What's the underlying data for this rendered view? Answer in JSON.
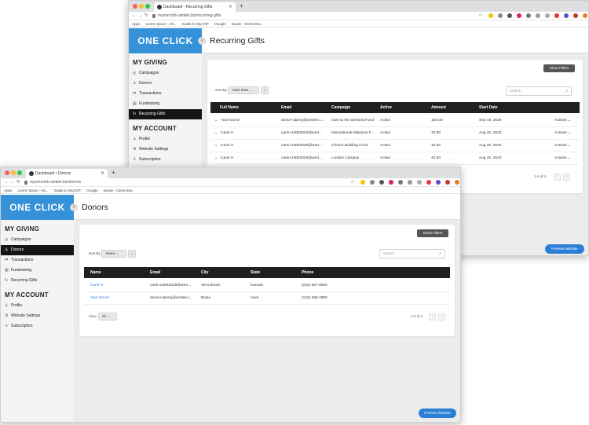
{
  "back_window": {
    "tab_title": "Dashboard - Recurring Gifts",
    "url": "myonnclick.wmtek.biz/recurring-gifts",
    "bookmarks": [
      "Apps",
      "Lorem Ipsum - All...",
      "Guide to WyAOP",
      "Google",
      "Bowie - Client Bra..."
    ],
    "logo": "ONE CLICK",
    "page_title": "Recurring Gifts",
    "sidebar": {
      "my_giving": "MY GIVING",
      "giving_items": [
        "Campaigns",
        "Donors",
        "Transactions",
        "Fundraising",
        "Recurring Gifts"
      ],
      "my_account": "MY ACCOUNT",
      "account_items": [
        "Profile",
        "Website Settings",
        "Subscription"
      ]
    },
    "show_filters": "Show Filters",
    "sort_by": "Sort By",
    "sort_value": "Start Date ⌄",
    "sort_dir": "↓",
    "search_placeholder": "Search",
    "columns": [
      "Full Name",
      "Email",
      "Campaign",
      "Active",
      "Amount",
      "Start Date"
    ],
    "rows": [
      {
        "name": "Your Donor",
        "email": "donor+danny@wmtek.c...",
        "campaign": "Give to the General Fund",
        "active": "Active",
        "amount": "100.00",
        "start": "Sep 19, 2020",
        "actions": "Actions ⌄"
      },
      {
        "name": "Caris H",
        "email": "caris+23082020@wmt...",
        "campaign": "International Missions F...",
        "active": "Active",
        "amount": "70.00",
        "start": "Aug 20, 2020",
        "actions": "Actions ⌄"
      },
      {
        "name": "Caris H",
        "email": "caris+23082020@wmt...",
        "campaign": "Church Building Fund",
        "active": "Active",
        "amount": "10.00",
        "start": "Aug 20, 2020",
        "actions": "Actions ⌄"
      },
      {
        "name": "Caris H",
        "email": "caris+23082020@wmt...",
        "campaign": "London Campus",
        "active": "Active",
        "amount": "40.00",
        "start": "Aug 20, 2020",
        "actions": "Actions ⌄"
      }
    ],
    "pager": "1-4 of 4",
    "preview": "Preview Website"
  },
  "front_window": {
    "tab_title": "Dashboard • Donors",
    "url": "myonnclick.wmtek.biz/donors",
    "bookmarks": [
      "Apps",
      "Lorem Ipsum - All...",
      "Guide to WyAOP",
      "Google",
      "Bowie - Client Bra..."
    ],
    "logo": "ONE CLICK",
    "page_title": "Donors",
    "sidebar": {
      "my_giving": "MY GIVING",
      "giving_items": [
        "Campaigns",
        "Donors",
        "Transactions",
        "Fundraising",
        "Recurring Gifts"
      ],
      "my_account": "MY ACCOUNT",
      "account_items": [
        "Profile",
        "Website Settings",
        "Subscription"
      ]
    },
    "show_filters": "Show Filters",
    "sort_by": "Sort By",
    "sort_value": "Name ⌄",
    "sort_dir": "↓",
    "search_placeholder": "Search",
    "columns": [
      "Name",
      "Email",
      "City",
      "State",
      "Phone"
    ],
    "rows": [
      {
        "name": "Caris H",
        "email": "caris+23082020@wmt...",
        "city": "Vero Beach",
        "state": "Kansas",
        "phone": "(234) 567-8900"
      },
      {
        "name": "Your Donor",
        "email": "donor+danny@wmtek.c...",
        "city": "Boise",
        "state": "Iowa",
        "phone": "(123) 456-7890"
      }
    ],
    "view_label": "View",
    "view_value": "25 ⌄",
    "pager": "1-2 of 2",
    "preview": "Preview Website"
  },
  "colors": {
    "brand": "#3592d8",
    "active_nav": "#151515",
    "table_header": "#202020",
    "preview": "#2c7fd6"
  }
}
